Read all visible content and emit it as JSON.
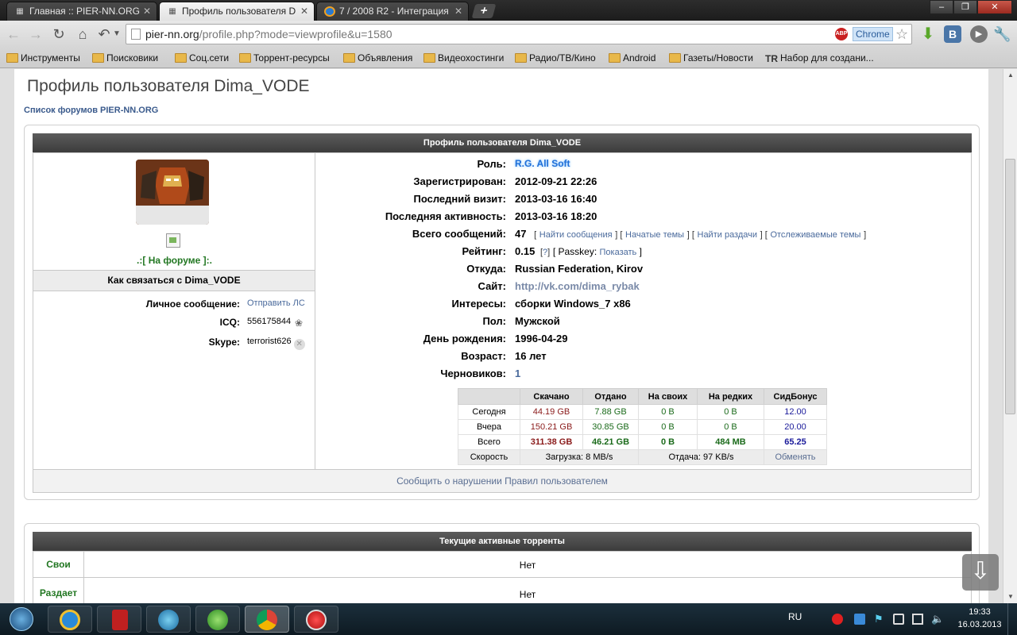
{
  "browser": {
    "tabs": [
      {
        "title": "Главная :: PIER-NN.ORG",
        "active": false
      },
      {
        "title": "Профиль пользователя D",
        "active": true
      },
      {
        "title": "7 / 2008 R2 - Интеграция",
        "active": false
      }
    ],
    "url_host": "pier-nn.org",
    "url_path": "/profile.php?mode=viewprofile&u=1580",
    "chrome_label": "Chrome",
    "abp_label": "ABP",
    "ext_vk_label": "В",
    "bookmarks": [
      {
        "label": "Инструменты",
        "icon": "folder-icon"
      },
      {
        "label": "Поисковики",
        "icon": "folder-icon"
      },
      {
        "label": "Соц.сети",
        "icon": "folder-icon"
      },
      {
        "label": "Торрент-ресурсы",
        "icon": "folder-icon"
      },
      {
        "label": "Объявления",
        "icon": "folder-icon"
      },
      {
        "label": "Видеохостинги",
        "icon": "folder-icon"
      },
      {
        "label": "Радио/ТВ/Кино",
        "icon": "folder-icon"
      },
      {
        "label": "Android",
        "icon": "folder-icon"
      },
      {
        "label": "Газеты/Новости",
        "icon": "folder-icon"
      },
      {
        "label": "Набор для создани...",
        "icon": "tr-icon",
        "icon_text": "TR"
      }
    ]
  },
  "page": {
    "title": "Профиль пользователя Dima_VODE",
    "breadcrumb": "Список форумов PIER-NN.ORG",
    "profile_header": "Профиль пользователя Dima_VODE",
    "online_status": ".:[ На форуме ]:.",
    "contact_header": "Как связаться с Dima_VODE",
    "contacts": {
      "pm_label": "Личное сообщение:",
      "pm_link": "Отправить ЛС",
      "icq_label": "ICQ:",
      "icq_value": "556175844",
      "skype_label": "Skype:",
      "skype_value": "terrorist626"
    },
    "profile": {
      "role_label": "Роль:",
      "role_value": "R.G. All Soft",
      "registered_label": "Зарегистрирован:",
      "registered_value": "2012-09-21 22:26",
      "last_visit_label": "Последний визит:",
      "last_visit_value": "2013-03-16 16:40",
      "last_activity_label": "Последняя активность:",
      "last_activity_value": "2013-03-16 18:20",
      "posts_label": "Всего сообщений:",
      "posts_value": "47",
      "posts_links": [
        "Найти сообщения",
        "Начатые темы",
        "Найти раздачи",
        "Отслеживаемые темы"
      ],
      "rating_label": "Рейтинг:",
      "rating_value": "0.15",
      "rating_help": "?",
      "passkey_label": "Passkey:",
      "passkey_link": "Показать",
      "from_label": "Откуда:",
      "from_value": "Russian Federation, Kirov",
      "site_label": "Сайт:",
      "site_value": "http://vk.com/dima_rybak",
      "interests_label": "Интересы:",
      "interests_value": "сборки Windows_7 x86",
      "gender_label": "Пол:",
      "gender_value": "Мужской",
      "birthday_label": "День рождения:",
      "birthday_value": "1996-04-29",
      "age_label": "Возраст:",
      "age_value": "16 лет",
      "drafts_label": "Черновиков:",
      "drafts_value": "1"
    },
    "stats": {
      "headers": [
        "",
        "Скачано",
        "Отдано",
        "На своих",
        "На редких",
        "СидБонус"
      ],
      "rows": [
        {
          "label": "Сегодня",
          "values": [
            "44.19 GB",
            "7.88 GB",
            "0 B",
            "0 B",
            "12.00"
          ]
        },
        {
          "label": "Вчера",
          "values": [
            "150.21 GB",
            "30.85 GB",
            "0 B",
            "0 B",
            "20.00"
          ]
        },
        {
          "label": "Всего",
          "values": [
            "311.38 GB",
            "46.21 GB",
            "0 B",
            "484 MB",
            "65.25"
          ]
        }
      ],
      "speed_label": "Скорость",
      "download_speed": "Загрузка: 8 MB/s",
      "upload_speed": "Отдача: 97 KB/s",
      "exchange_link": "Обменять"
    },
    "report_link": "Сообщить о нарушении Правил пользователем",
    "torrents_header": "Текущие активные торренты",
    "torrent_rows": [
      {
        "label": "Свои",
        "value": "Нет"
      },
      {
        "label": "Раздает",
        "value": "Нет"
      }
    ]
  },
  "taskbar": {
    "language": "RU",
    "time": "19:33",
    "date": "16.03.2013"
  }
}
